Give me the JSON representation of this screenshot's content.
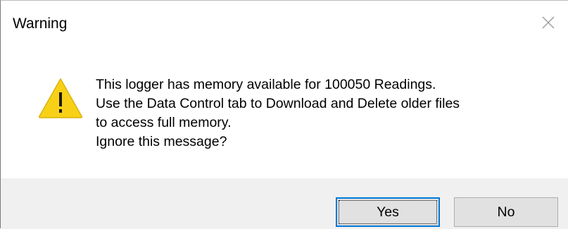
{
  "dialog": {
    "title": "Warning",
    "close_icon": "close-icon",
    "warning_icon": "warning-triangle-icon",
    "warning_icon_color": "#f8d116",
    "message_lines": [
      "This logger has memory available for 100050 Readings.",
      "Use the Data Control tab to Download and Delete older files",
      "to access full memory.",
      "Ignore this message?"
    ],
    "buttons": {
      "yes_label": "Yes",
      "no_label": "No"
    },
    "accent_color": "#0078d7"
  }
}
